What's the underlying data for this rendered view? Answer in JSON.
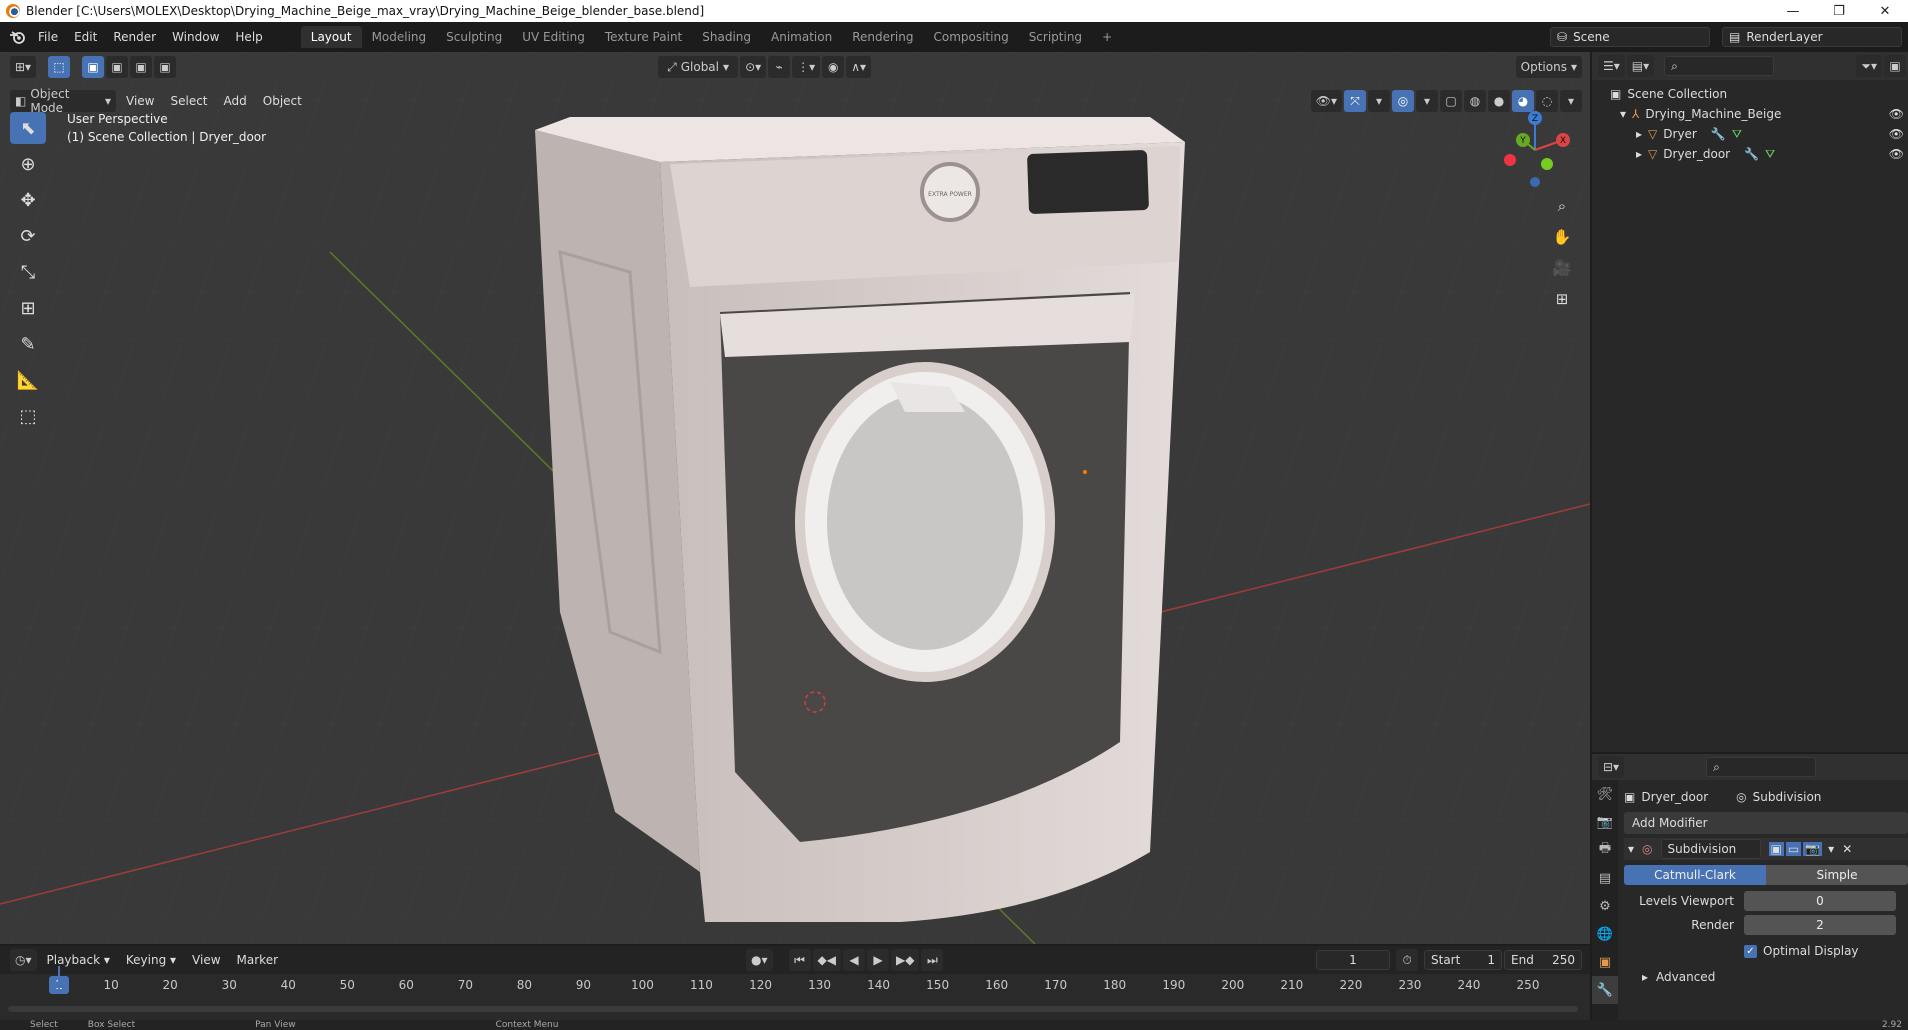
{
  "window": {
    "title": "Blender [C:\\Users\\MOLEX\\Desktop\\Drying_Machine_Beige_max_vray\\Drying_Machine_Beige_blender_base.blend]",
    "minimize": "—",
    "restore": "❐",
    "close": "✕"
  },
  "menu": {
    "items": [
      "File",
      "Edit",
      "Render",
      "Window",
      "Help"
    ]
  },
  "workspaces": {
    "tabs": [
      "Layout",
      "Modeling",
      "Sculpting",
      "UV Editing",
      "Texture Paint",
      "Shading",
      "Animation",
      "Rendering",
      "Compositing",
      "Scripting"
    ],
    "active": "Layout",
    "add": "+"
  },
  "scene": {
    "name": "Scene",
    "render_layer": "RenderLayer"
  },
  "viewport": {
    "mode": "Object Mode",
    "menus": [
      "View",
      "Select",
      "Add",
      "Object"
    ],
    "orientation": "Global",
    "options": "Options",
    "info_line1": "User Perspective",
    "info_line2": "(1) Scene Collection | Dryer_door",
    "brand_text": "EXTRA POWER"
  },
  "gizmo": {
    "x": "X",
    "y": "Y",
    "z": "Z"
  },
  "timeline": {
    "menus": [
      "Playback",
      "Keying",
      "View",
      "Marker"
    ],
    "current_frame": "1",
    "start_label": "Start",
    "start": "1",
    "end_label": "End",
    "end": "250",
    "cursor": "1",
    "ticks": [
      "10",
      "20",
      "30",
      "40",
      "50",
      "60",
      "70",
      "80",
      "90",
      "100",
      "110",
      "120",
      "130",
      "140",
      "150",
      "160",
      "170",
      "180",
      "190",
      "200",
      "210",
      "220",
      "230",
      "240",
      "250"
    ]
  },
  "statusbar": {
    "select": "Select",
    "box_select": "Box Select",
    "pan_view": "Pan View",
    "context_menu": "Context Menu",
    "version": "2.92"
  },
  "outliner": {
    "root": "Scene Collection",
    "collection": "Drying_Machine_Beige",
    "objects": [
      "Dryer",
      "Dryer_door"
    ]
  },
  "properties": {
    "object": "Dryer_door",
    "modifier_crumb": "Subdivision",
    "add_modifier": "Add Modifier",
    "modifier_name": "Subdivision",
    "catmull": "Catmull-Clark",
    "simple": "Simple",
    "levels_viewport_label": "Levels Viewport",
    "levels_viewport": "0",
    "render_label": "Render",
    "render": "2",
    "optimal_display": "Optimal Display",
    "advanced": "Advanced"
  }
}
